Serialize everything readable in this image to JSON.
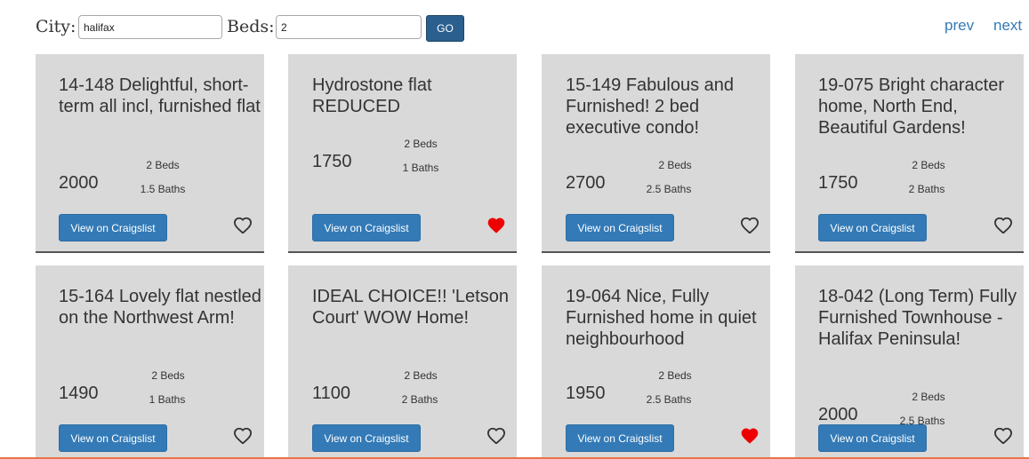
{
  "search": {
    "city_label": "City:",
    "city_value": "halifax",
    "beds_label": "Beds:",
    "beds_value": "2",
    "go_label": "GO"
  },
  "pager": {
    "prev": "prev",
    "next": "next"
  },
  "listings": [
    {
      "title": "14-148 Delightful, short-term all incl, furnished flat",
      "price": "2000",
      "beds": "2 Beds",
      "baths": "1.5 Baths",
      "button": "View on Craigslist",
      "favorited": false
    },
    {
      "title": "Hydrostone flat REDUCED",
      "price": "1750",
      "beds": "2 Beds",
      "baths": "1 Baths",
      "button": "View on Craigslist",
      "favorited": true
    },
    {
      "title": "15-149 Fabulous and Furnished! 2 bed executive condo!",
      "price": "2700",
      "beds": "2 Beds",
      "baths": "2.5 Baths",
      "button": "View on Craigslist",
      "favorited": false
    },
    {
      "title": "19-075 Bright character home, North End, Beautiful Gardens!",
      "price": "1750",
      "beds": "2 Beds",
      "baths": "2 Baths",
      "button": "View on Craigslist",
      "favorited": false
    },
    {
      "title": "15-164 Lovely flat nestled on the Northwest Arm!",
      "price": "1490",
      "beds": "2 Beds",
      "baths": "1 Baths",
      "button": "View on Craigslist",
      "favorited": false
    },
    {
      "title": "IDEAL CHOICE!! 'Letson Court' WOW Home!",
      "price": "1100",
      "beds": "2 Beds",
      "baths": "2 Baths",
      "button": "View on Craigslist",
      "favorited": false
    },
    {
      "title": "19-064 Nice, Fully Furnished home in quiet neighbourhood",
      "price": "1950",
      "beds": "2 Beds",
      "baths": "2.5 Baths",
      "button": "View on Craigslist",
      "favorited": true
    },
    {
      "title": "18-042 (Long Term) Fully Furnished Townhouse - Halifax Peninsula!",
      "price": "2000",
      "beds": "2 Beds",
      "baths": "2.5 Baths",
      "button": "View on Craigslist",
      "favorited": false
    }
  ],
  "colors": {
    "card_bg": "#d9d9d9",
    "button_blue": "#337ab7",
    "go_button": "#2a5f8e",
    "link_blue": "#337ab7",
    "heart_filled": "#ee0000",
    "heart_outline": "#333333"
  },
  "icons": {
    "favorite": "heart-icon"
  }
}
